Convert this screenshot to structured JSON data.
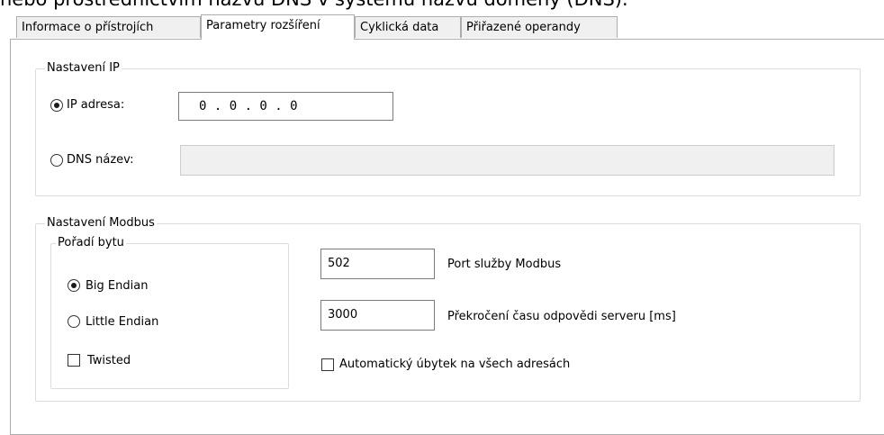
{
  "header_text": "nebo prostřednictvím názvu DNS v systému názvu domény (DNS).",
  "tabs": [
    {
      "label": "Informace o přístrojích"
    },
    {
      "label": "Parametry rozšíření"
    },
    {
      "label": "Cyklická data"
    },
    {
      "label": "Přiřazené operandy"
    }
  ],
  "ip_settings": {
    "legend": "Nastavení IP",
    "ip_radio_label": "IP adresa:",
    "ip_value": "0  .  0  .  0  .  0",
    "dns_radio_label": "DNS název:",
    "dns_value": ""
  },
  "modbus_settings": {
    "legend": "Nastavení Modbus",
    "byte_order": {
      "legend": "Pořadí bytu",
      "big_endian": "Big Endian",
      "little_endian": "Little Endian",
      "twisted": "Twisted"
    },
    "port_value": "502",
    "port_label": "Port služby Modbus",
    "timeout_value": "3000",
    "timeout_label": "Překročení času odpovědi serveru [ms]",
    "auto_decrement_label": "Automatický úbytek na všech adresách"
  }
}
